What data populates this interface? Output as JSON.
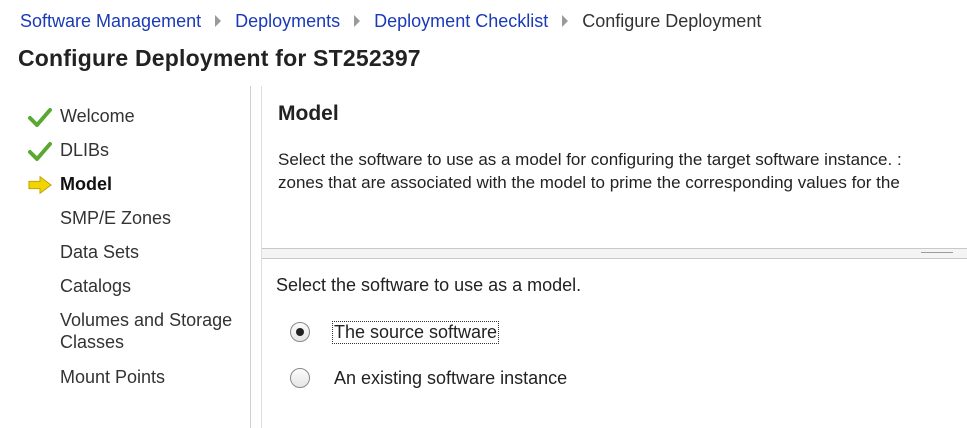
{
  "breadcrumb": {
    "items": [
      "Software Management",
      "Deployments",
      "Deployment Checklist"
    ],
    "current": "Configure Deployment"
  },
  "page": {
    "title": "Configure Deployment for ST252397"
  },
  "sidebar": {
    "items": [
      {
        "label": "Welcome",
        "state": "done"
      },
      {
        "label": "DLIBs",
        "state": "done"
      },
      {
        "label": "Model",
        "state": "current"
      },
      {
        "label": "SMP/E Zones",
        "state": "pending"
      },
      {
        "label": "Data Sets",
        "state": "pending"
      },
      {
        "label": "Catalogs",
        "state": "pending"
      },
      {
        "label": "Volumes and Storage Classes",
        "state": "pending"
      },
      {
        "label": "Mount Points",
        "state": "pending"
      }
    ]
  },
  "content": {
    "title": "Model",
    "description_line1": "Select the software to use as a model for configuring the target software instance.  :",
    "description_line2": "zones that are associated with the model to prime the corresponding values for the",
    "select_prompt": "Select the software to use as a model.",
    "options": [
      {
        "label": "The source software",
        "checked": true
      },
      {
        "label": "An existing software instance",
        "checked": false
      }
    ]
  },
  "colors": {
    "link": "#1a3ab8",
    "check": "#5aa832",
    "arrow": "#f2d500"
  }
}
